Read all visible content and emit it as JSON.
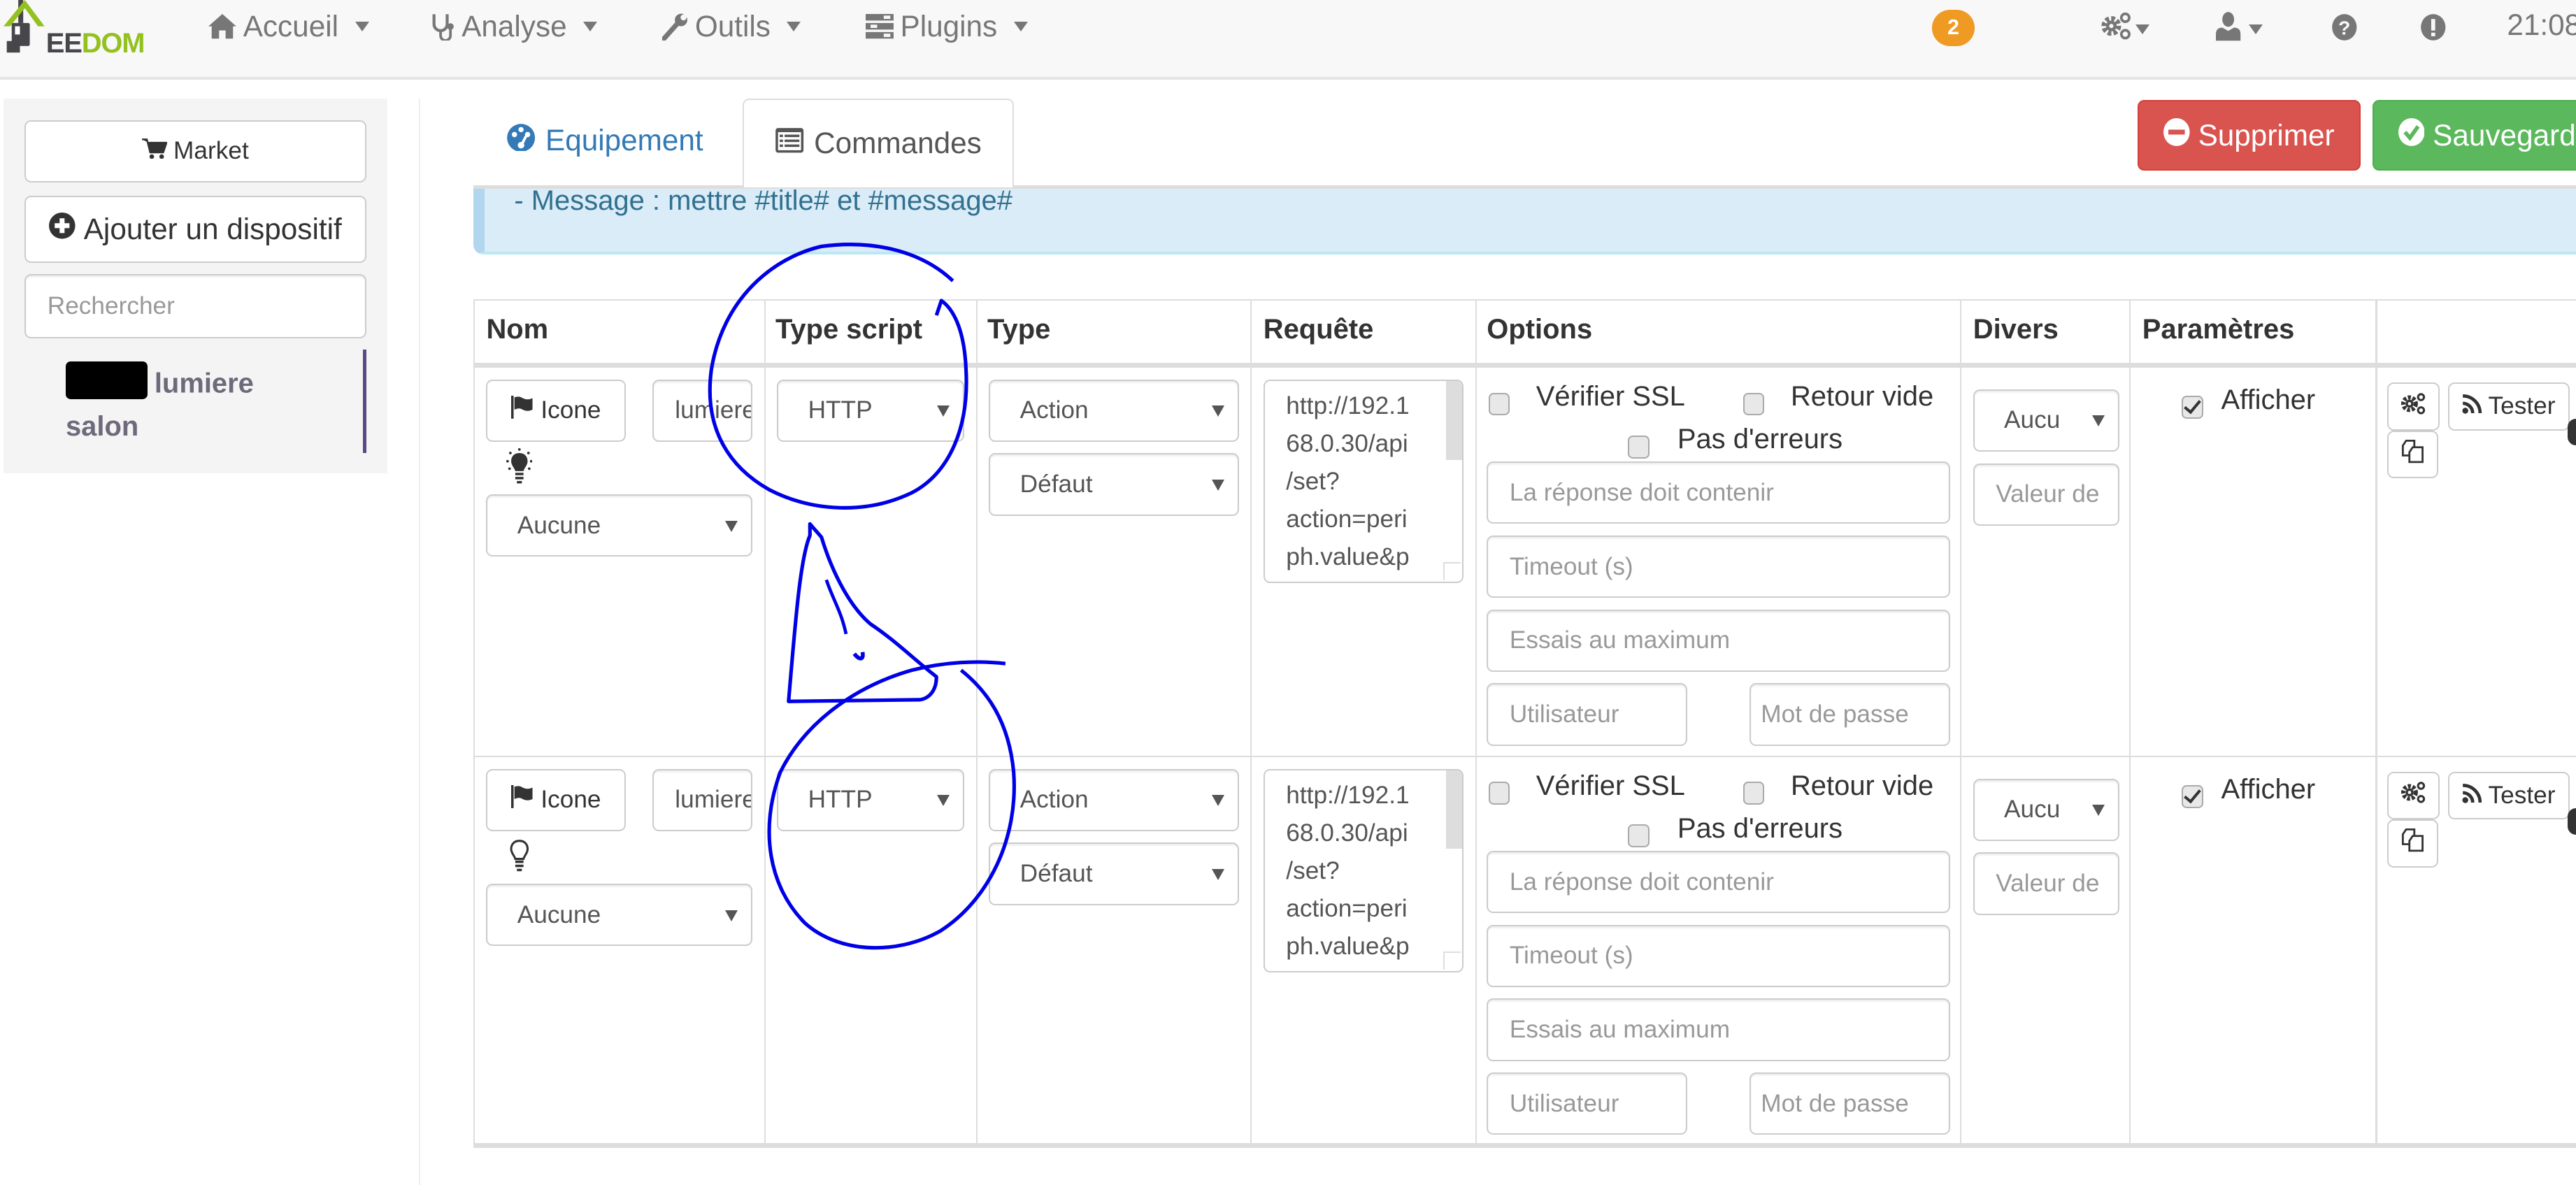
{
  "topnav": {
    "logo": {
      "text_dark": "EE",
      "text_green": "DOM"
    },
    "menus": [
      {
        "label": "Accueil",
        "icon": "home-icon"
      },
      {
        "label": "Analyse",
        "icon": "stethoscope-icon"
      },
      {
        "label": "Outils",
        "icon": "wrench-icon"
      },
      {
        "label": "Plugins",
        "icon": "tasks-icon"
      }
    ],
    "notification_count": "2",
    "clock": "21:08",
    "right_icons": [
      "cogs-icon",
      "user-icon",
      "question-icon",
      "exclamation-icon"
    ]
  },
  "sidebar": {
    "market_label": "Market",
    "add_device_label": "Ajouter un dispositif",
    "search_placeholder": "Rechercher",
    "equipment": {
      "name_line1": "lumiere",
      "name_line2": "salon"
    }
  },
  "tabs": [
    {
      "label": "Equipement",
      "active": false
    },
    {
      "label": "Commandes",
      "active": true
    }
  ],
  "actions": {
    "delete_label": "Supprimer",
    "save_label": "Sauvegarder"
  },
  "alert": {
    "text": "- Message : mettre #title# et #message#"
  },
  "colors": {
    "danger": "#d9534f",
    "success": "#5cb85c",
    "link": "#337ab7",
    "badge": "#ef9a22",
    "info_bg": "#d9ecf7",
    "annotation": "#0000e6"
  },
  "table": {
    "headers": [
      "Nom",
      "Type script",
      "Type",
      "Requête",
      "Options",
      "Divers",
      "Paramètres",
      ""
    ],
    "rows": [
      {
        "icon_button": "Icone",
        "name_value": "lumiere",
        "state_icon": "lightbulb-on-icon",
        "value_select": "Aucune",
        "script_type": "HTTP",
        "type": "Action",
        "subtype": "Défaut",
        "request": "http://192.168.0.30/api/set?action=periph.value&p",
        "request_lines": [
          "http://192.1",
          "68.0.30/api",
          "/set?",
          "action=peri",
          "ph.value&p"
        ],
        "options": {
          "verify_ssl_label": "Vérifier SSL",
          "verify_ssl": false,
          "empty_return_label": "Retour vide",
          "empty_return": false,
          "no_errors_label": "Pas d'erreurs",
          "no_errors": false,
          "response_placeholder": "La réponse doit contenir",
          "timeout_placeholder": "Timeout (s)",
          "max_tries_placeholder": "Essais au maximum",
          "user_placeholder": "Utilisateur",
          "password_placeholder": "Mot de passe"
        },
        "divers_select": "Aucu",
        "divers_placeholder": "Valeur de",
        "display_label": "Afficher",
        "display": true,
        "test_label": "Tester"
      },
      {
        "icon_button": "Icone",
        "name_value": "lumiere",
        "state_icon": "lightbulb-off-icon",
        "value_select": "Aucune",
        "script_type": "HTTP",
        "type": "Action",
        "subtype": "Défaut",
        "request": "http://192.168.0.30/api/set?action=periph.value&p",
        "request_lines": [
          "http://192.1",
          "68.0.30/api",
          "/set?",
          "action=peri",
          "ph.value&p"
        ],
        "options": {
          "verify_ssl_label": "Vérifier SSL",
          "verify_ssl": false,
          "empty_return_label": "Retour vide",
          "empty_return": false,
          "no_errors_label": "Pas d'erreurs",
          "no_errors": false,
          "response_placeholder": "La réponse doit contenir",
          "timeout_placeholder": "Timeout (s)",
          "max_tries_placeholder": "Essais au maximum",
          "user_placeholder": "Utilisateur",
          "password_placeholder": "Mot de passe"
        },
        "divers_select": "Aucu",
        "divers_placeholder": "Valeur de",
        "display_label": "Afficher",
        "display": true,
        "test_label": "Tester"
      }
    ]
  },
  "annotations": [
    "circle-around-type-script-row-1",
    "triangle-sketch",
    "circle-around-type-script-row-2"
  ]
}
